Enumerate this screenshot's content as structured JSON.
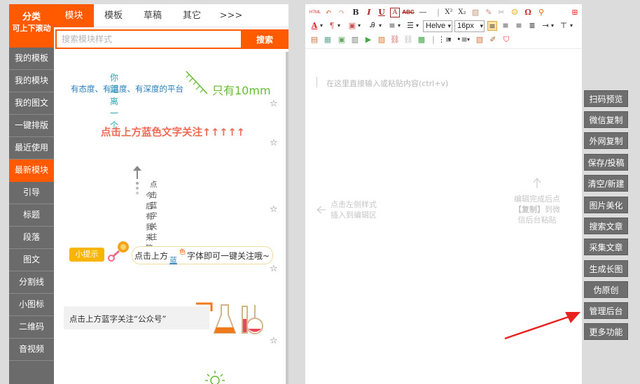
{
  "sidebar": {
    "title_line1": "分类",
    "title_line2": "可上下滚动",
    "items": [
      "我的模板",
      "我的模块",
      "我的图文",
      "一键排版",
      "最近使用",
      "最新模块",
      "引导",
      "标题",
      "段落",
      "图文",
      "分割线",
      "小图标",
      "二维码",
      "音视频"
    ],
    "active_item": "最新模块"
  },
  "tabs": [
    "模块",
    "模板",
    "草稿",
    "其它",
    ">>>"
  ],
  "search": {
    "placeholder": "搜索模块样式",
    "button": "搜索"
  },
  "samples": {
    "s1_top": "你距离一个",
    "s1_mid": "有态度、有温度、有深度的平台",
    "s1_big": "只有10mm",
    "s2": "点击上方蓝色文字关注↑↑↑↑↑",
    "s3_line1": "点击蓝字关注",
    "s3_line2": "今后有我来陪你",
    "s4_badge": "小提示",
    "s4_pre": "点击上方",
    "s4_sup": "色",
    "s4_blue": "蓝",
    "s4_post": "字体即可一键关注哦~",
    "s5": "点击上方蓝字关注“公众号”"
  },
  "toolbar": {
    "font_family": "Helve",
    "font_size": "16px",
    "abc_label": "ABC",
    "html_label": "HTML"
  },
  "editor": {
    "placeholder": "在这里直接输入或粘贴内容(ctrl+v)",
    "hint_left_line1": "点击左侧样式",
    "hint_left_line2": "插入到编辑区",
    "hint_right_line1": "编辑完成后点",
    "hint_right_bold": "【复制】",
    "hint_right_tail": "到微",
    "hint_right_line3": "信后台粘贴"
  },
  "actions": [
    "扫码预览",
    "微信复制",
    "外网复制",
    "保存/投稿",
    "清空/新建",
    "图片美化",
    "搜索文章",
    "采集文章",
    "生成长图",
    "伪原创",
    "管理后台",
    "更多功能"
  ],
  "colors": {
    "accent": "#ff5a00",
    "sidebar": "#6b6b6b",
    "button": "#6e6e6e",
    "arrow": "#e8231f"
  }
}
